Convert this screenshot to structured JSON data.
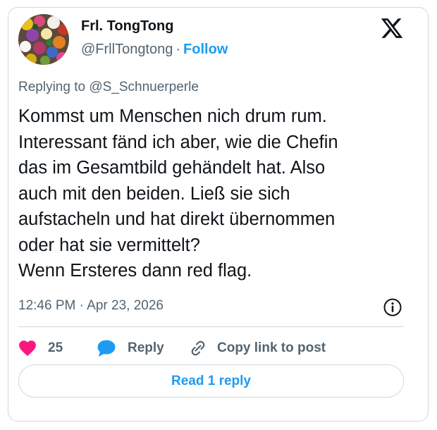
{
  "author": {
    "display_name": "Frl. TongTong",
    "handle": "@FrllTongtong",
    "separator": "·",
    "follow_label": "Follow"
  },
  "replying_to": {
    "prefix": "Replying to ",
    "mention": "@S_Schnuerperle"
  },
  "tweet_text": "Kommst um Menschen nich drum rum.\nInteressant fänd ich aber, wie die Chefin\ndas im Gesamtbild gehändelt hat. Also\nauch mit den beiden. Ließ sie sich\naufstacheln und hat direkt übernommen\noder hat sie vermittelt?\nWenn Ersteres dann red flag.",
  "timestamp": "12:46 PM · Apr 23, 2026",
  "actions": {
    "like_count": "25",
    "reply_label": "Reply",
    "copy_link_label": "Copy link to post"
  },
  "read_replies_label": "Read 1 reply",
  "icons": {
    "brand": "x-logo-icon",
    "info": "info-icon",
    "like": "heart-icon",
    "reply": "speech-bubble-icon",
    "copy": "link-icon"
  },
  "colors": {
    "accent": "#1d9bf0",
    "like": "#f91880",
    "secondary_text": "#536471",
    "border": "#cfd9de"
  }
}
